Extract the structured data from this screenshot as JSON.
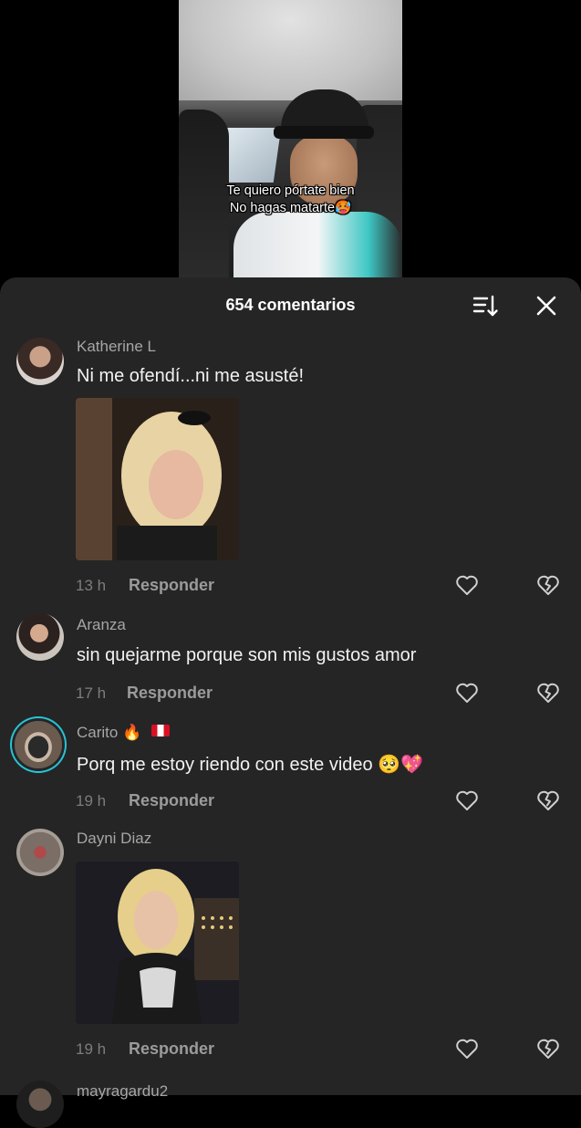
{
  "video": {
    "caption_line1": "Te quiero pórtate bien",
    "caption_line2": "No hagas matarte🥵"
  },
  "panel": {
    "title": "654 comentarios",
    "sort_icon": "sort-icon",
    "close_icon": "close-icon"
  },
  "comments": [
    {
      "username": "Katherine L",
      "text": "Ni me ofendí...ni me asusté!",
      "has_media": true,
      "time": "13 h",
      "reply_label": "Responder"
    },
    {
      "username": "Aranza",
      "text": "sin quejarme porque son mis gustos amor",
      "has_media": false,
      "time": "17 h",
      "reply_label": "Responder"
    },
    {
      "username": "Carito",
      "username_emoji": "🔥",
      "text": "Porq me estoy riendo con este video",
      "text_emoji": "🥺💖",
      "has_media": false,
      "time": "19 h",
      "reply_label": "Responder"
    },
    {
      "username": "Dayni Diaz",
      "has_media": true,
      "time": "19 h",
      "reply_label": "Responder"
    },
    {
      "username": "mayragardu2"
    }
  ],
  "colors": {
    "panel_bg": "#252525",
    "username": "#a6a6a6",
    "time": "#7d7d7d",
    "story_ring": "#27c4d8"
  }
}
